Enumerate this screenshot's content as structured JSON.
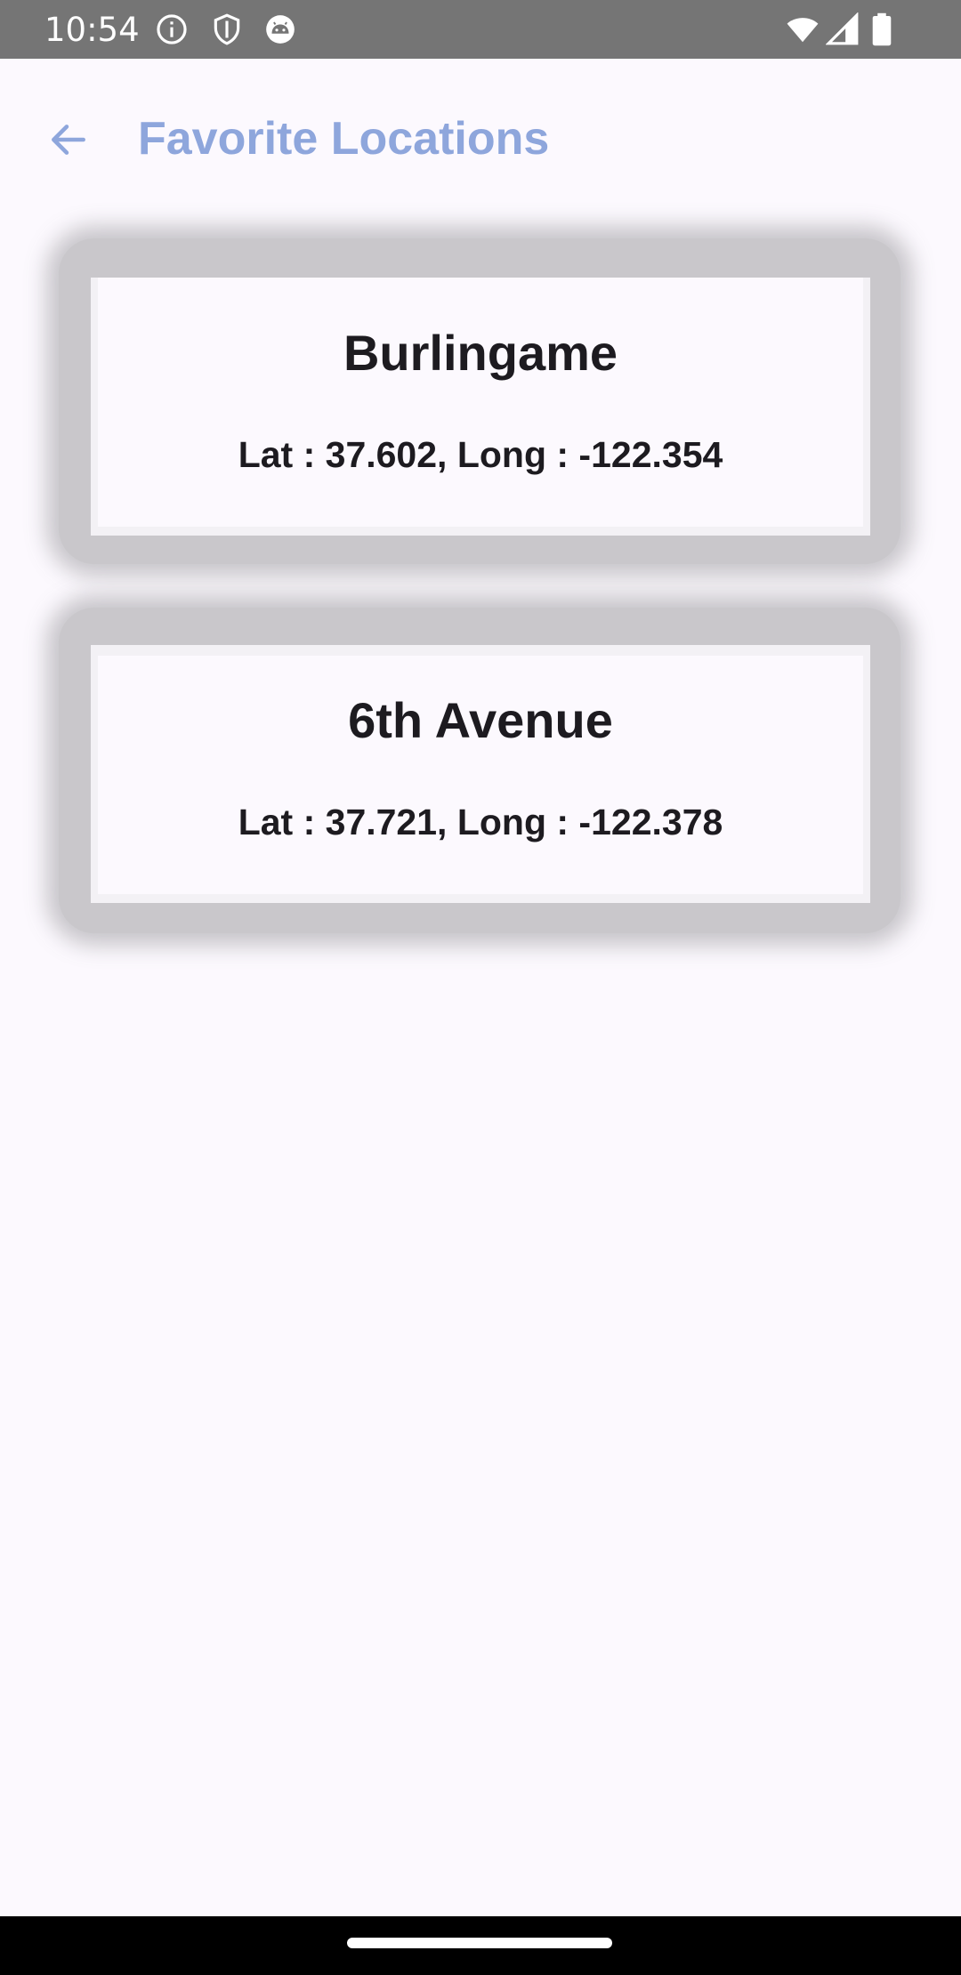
{
  "status_bar": {
    "time": "10:54",
    "icons": [
      "info-icon",
      "shield-icon",
      "android-icon",
      "wifi-icon",
      "signal-icon",
      "battery-icon"
    ]
  },
  "app_bar": {
    "title": "Favorite Locations",
    "back_icon": "arrow-left-icon",
    "title_color": "#8ea6dc"
  },
  "locations": [
    {
      "name": "Burlingame",
      "coords": "Lat : 37.602, Long : -122.354"
    },
    {
      "name": "6th Avenue",
      "coords": "Lat : 37.721, Long : -122.378"
    }
  ],
  "colors": {
    "background": "#fcf9fe",
    "text": "#1d1b20",
    "status_bar": "#757575",
    "nav_bar": "#000000"
  }
}
